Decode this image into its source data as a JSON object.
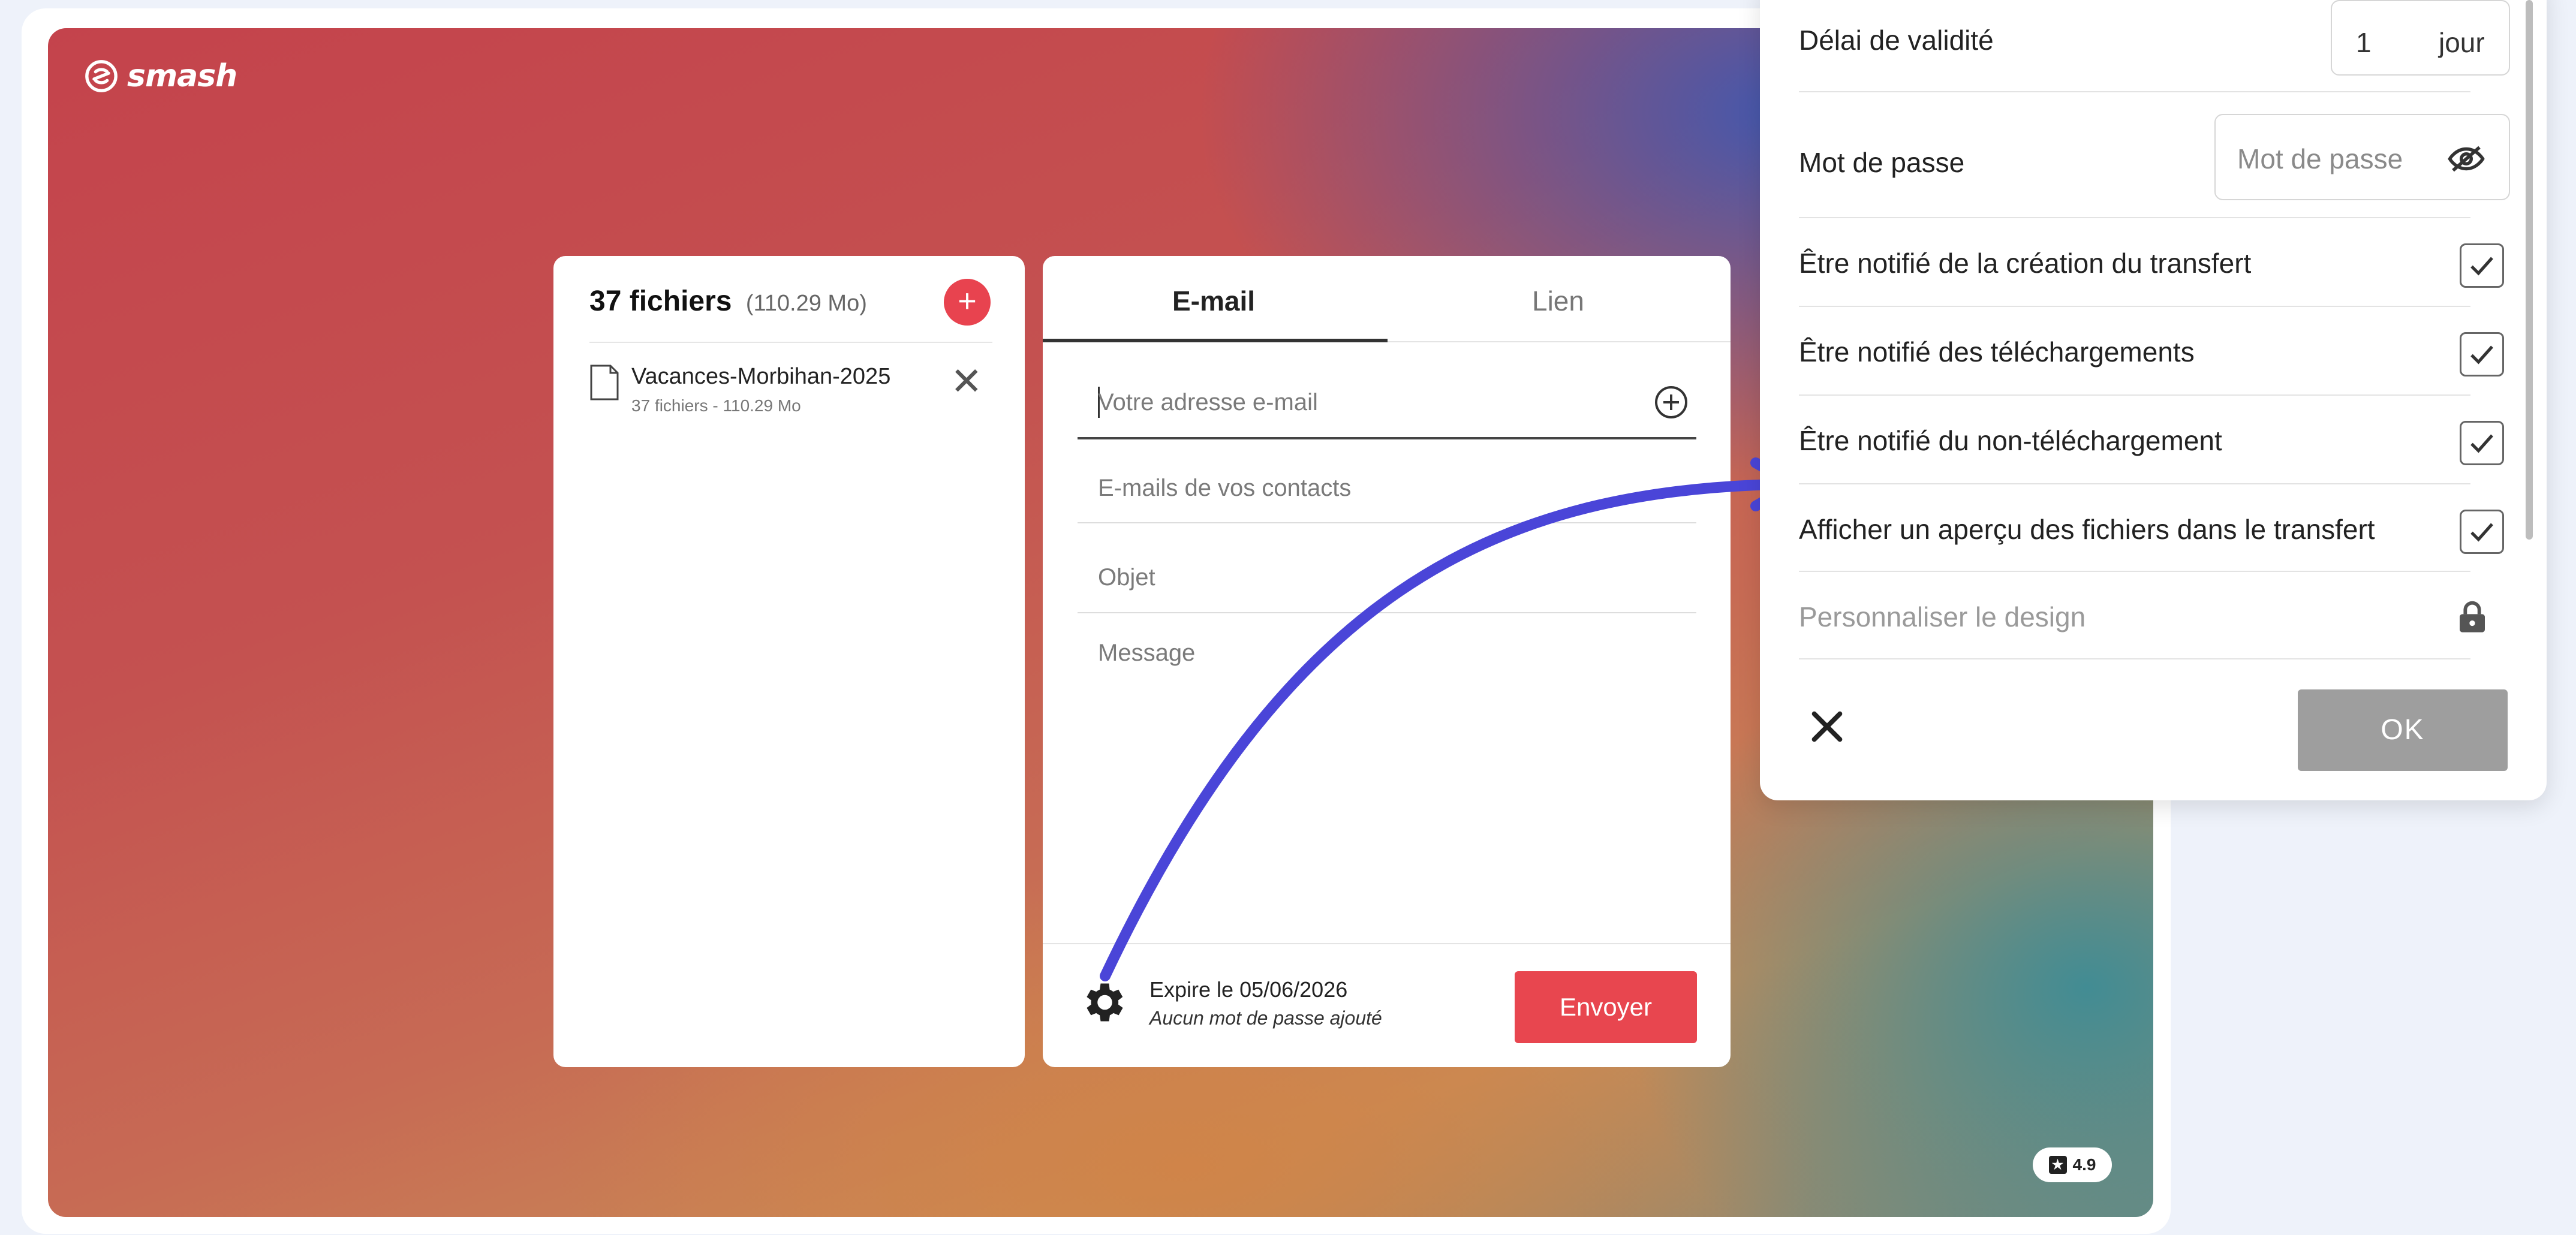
{
  "brand": {
    "name": "smash"
  },
  "rating": {
    "value": "4.9"
  },
  "files_panel": {
    "count_label": "37 fichiers",
    "total_size": "(110.29 Mo)",
    "add_label": "+",
    "items": [
      {
        "name": "Vacances-Morbihan-2025",
        "meta": "37 fichiers - 110.29 Mo"
      }
    ]
  },
  "send_panel": {
    "tabs": [
      {
        "label": "E-mail",
        "active": true
      },
      {
        "label": "Lien",
        "active": false
      }
    ],
    "email_placeholder": "Votre adresse e-mail",
    "contacts_placeholder": "E-mails de vos contacts",
    "subject_placeholder": "Objet",
    "message_placeholder": "Message",
    "expire_text": "Expire le 05/06/2026",
    "password_status": "Aucun mot de passe ajouté",
    "send_label": "Envoyer"
  },
  "settings_panel": {
    "validity_label": "Délai de validité",
    "validity_value": "1",
    "validity_unit": "jour",
    "password_label": "Mot de passe",
    "password_placeholder": "Mot de passe",
    "options": [
      {
        "label": "Être notifié de la création du transfert",
        "checked": true
      },
      {
        "label": "Être notifié des téléchargements",
        "checked": true
      },
      {
        "label": "Être notifié du non-téléchargement",
        "checked": true
      },
      {
        "label": "Afficher un aperçu des fichiers dans le transfert",
        "checked": true
      }
    ],
    "design_label": "Personnaliser le design",
    "ok_label": "OK"
  },
  "colors": {
    "accent_red": "#e8464f",
    "arrow": "#4a45d8",
    "ok_disabled": "#9e9e9e"
  },
  "icons": [
    "smash-logo-icon",
    "star-icon",
    "file-icon",
    "close-icon",
    "add-circle-icon",
    "gear-icon",
    "eye-off-icon",
    "check-icon",
    "lock-icon"
  ]
}
